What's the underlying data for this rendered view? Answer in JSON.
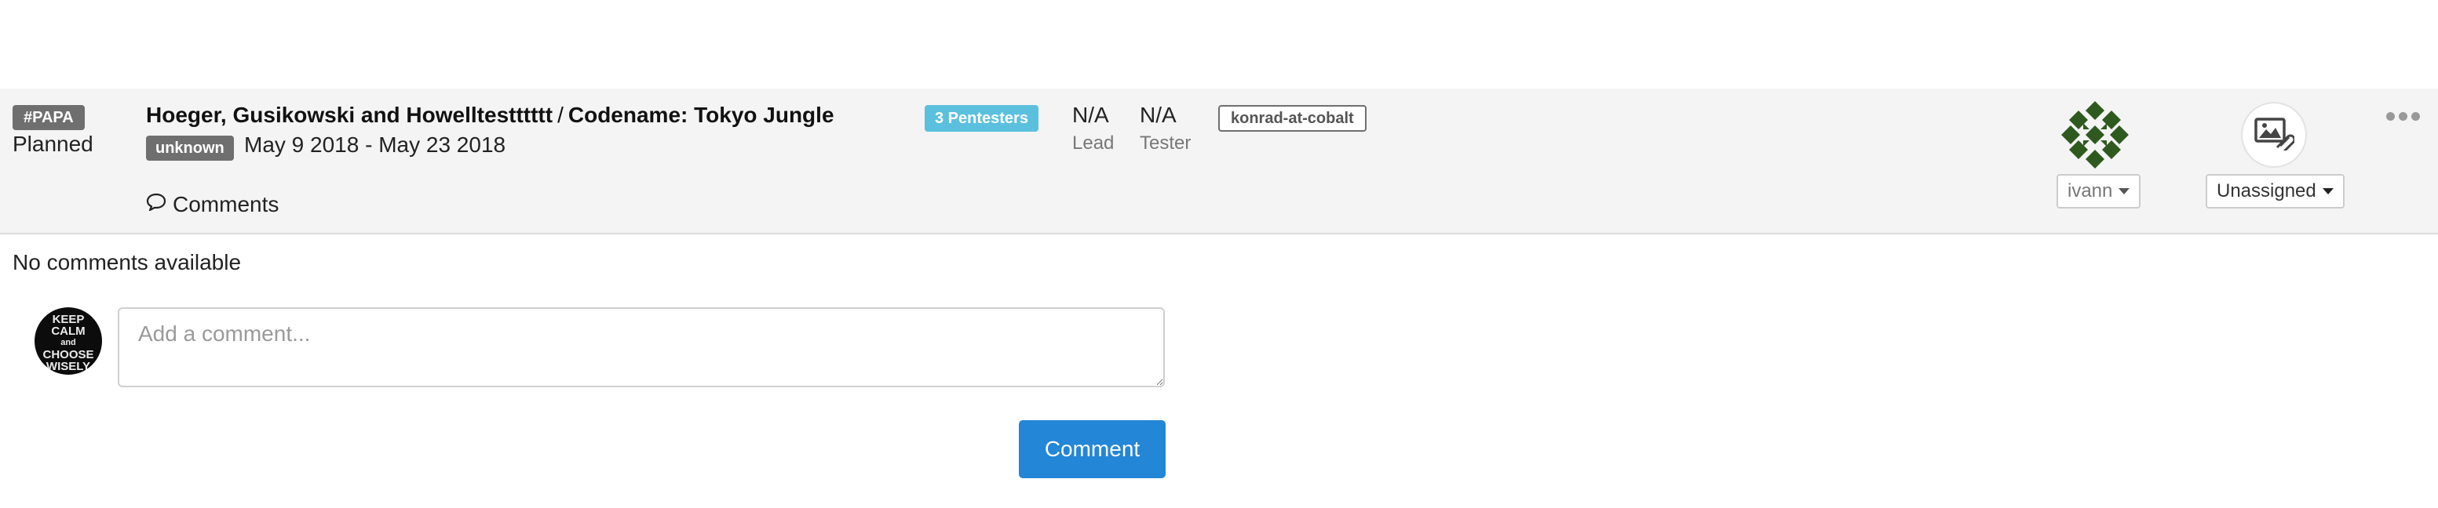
{
  "project": {
    "id_badge": "#PAPA",
    "status": "Planned",
    "org": "Hoeger, Gusikowski and Howelltestttttt",
    "separator": "/",
    "codename": "Codename: Tokyo Jungle",
    "type_badge": "unknown",
    "date_range": "May 9 2018 - May 23 2018",
    "comments_link": "Comments",
    "pentesters_badge": "3 Pentesters",
    "lead": {
      "value": "N/A",
      "label": "Lead"
    },
    "tester": {
      "value": "N/A",
      "label": "Tester"
    },
    "handle_badge": "konrad-at-cobalt",
    "owner_dropdown": "ivann",
    "assignee_dropdown": "Unassigned"
  },
  "comments": {
    "empty_text": "No comments available",
    "input_placeholder": "Add a comment...",
    "submit_label": "Comment",
    "user_avatar_text": [
      "KEEP",
      "CALM",
      "and",
      "CHOOSE",
      "WISELY"
    ]
  },
  "colors": {
    "row_bg": "#f4f4f4",
    "badge_gray": "#6f6f6f",
    "badge_info": "#5bc0de",
    "primary_button": "#2486d6",
    "identicon": "#2f5a1f"
  },
  "icons": {
    "comments": "speech-bubble-icon",
    "attachment": "image-attachment-icon",
    "more": "ellipsis-icon",
    "caret": "caret-down-icon"
  }
}
